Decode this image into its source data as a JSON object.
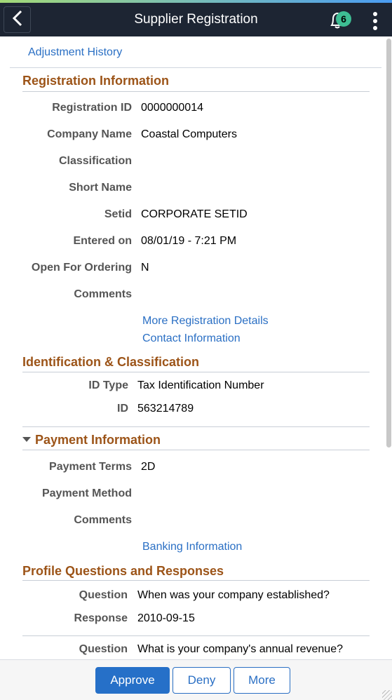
{
  "header": {
    "title": "Supplier Registration",
    "notification_count": "6",
    "icons": {
      "back": "chevron-left-icon",
      "notifications": "bell-icon",
      "menu": "kebab-menu-icon"
    }
  },
  "links": {
    "adjustment_history": "Adjustment History",
    "more_registration_details": "More Registration Details",
    "contact_information": "Contact Information",
    "banking_information": "Banking Information"
  },
  "registration": {
    "title": "Registration Information",
    "fields": [
      {
        "label": "Registration ID",
        "value": "0000000014"
      },
      {
        "label": "Company Name",
        "value": "Coastal Computers"
      },
      {
        "label": "Classification",
        "value": ""
      },
      {
        "label": "Short Name",
        "value": ""
      },
      {
        "label": "Setid",
        "value": "CORPORATE SETID"
      },
      {
        "label": "Entered on",
        "value": "08/01/19 - 7:21 PM"
      },
      {
        "label": "Open For Ordering",
        "value": "N"
      },
      {
        "label": "Comments",
        "value": ""
      }
    ]
  },
  "identification": {
    "title": "Identification & Classification",
    "fields": [
      {
        "label": "ID Type",
        "value": "Tax Identification Number"
      },
      {
        "label": "ID",
        "value": "563214789"
      }
    ]
  },
  "payment": {
    "title": "Payment Information",
    "expanded": true,
    "fields": [
      {
        "label": "Payment Terms",
        "value": "2D"
      },
      {
        "label": "Payment Method",
        "value": ""
      },
      {
        "label": "Comments",
        "value": ""
      }
    ]
  },
  "profile": {
    "title": "Profile Questions and Responses",
    "items": [
      {
        "question_label": "Question",
        "question": "When was your company established?",
        "response_label": "Response",
        "response": "2010-09-15"
      },
      {
        "question_label": "Question",
        "question": "What is your company's annual revenue?"
      }
    ]
  },
  "footer": {
    "approve": "Approve",
    "deny": "Deny",
    "more": "More"
  },
  "colors": {
    "header_bg": "#1d2533",
    "section_title": "#9c5418",
    "link": "#2a6fc4",
    "primary_button": "#2670c8",
    "badge": "#3dbd93"
  }
}
